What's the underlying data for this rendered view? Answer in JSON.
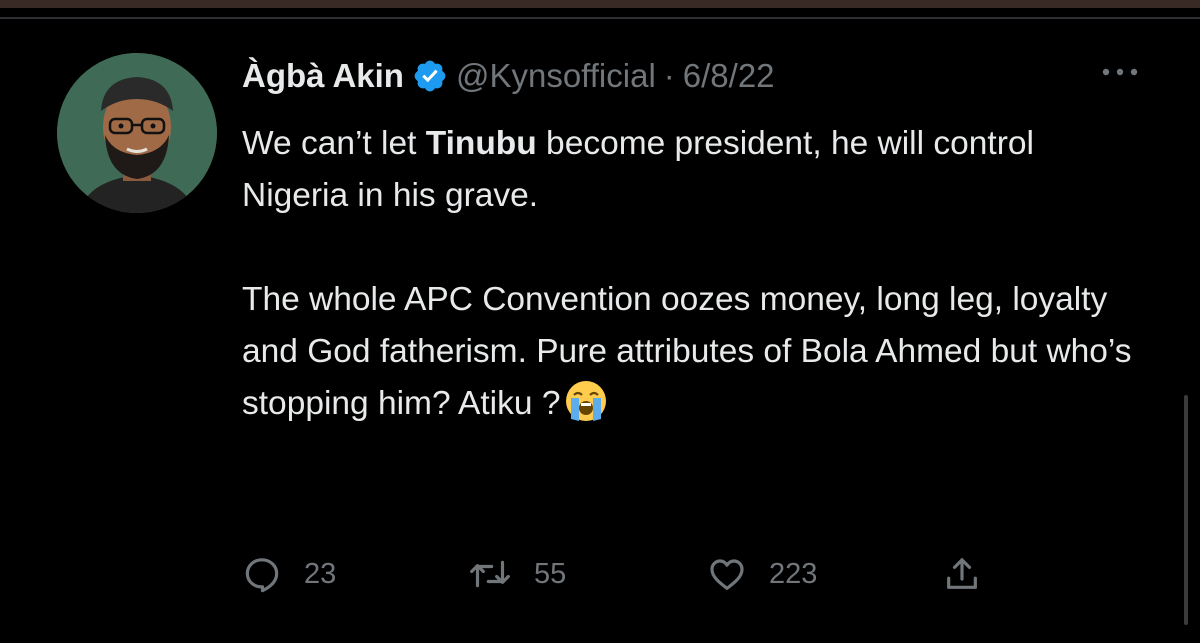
{
  "tweet": {
    "display_name": "Àgbà Akin",
    "handle": "@Kynsofficial",
    "separator": "·",
    "date": "6/8/22",
    "body": {
      "line1_before": "We can’t let ",
      "line1_bold": "Tinubu",
      "line1_after": " become president, he will control Nigeria in his grave.",
      "paragraph2": "The whole APC Convention oozes money, long leg, loyalty and God fatherism. Pure attributes of Bola Ahmed but who’s stopping him? Atiku ?"
    },
    "emoji": "loudly-crying-face",
    "metrics": {
      "replies": "23",
      "retweets": "55",
      "likes": "223"
    }
  },
  "icons": {
    "verified": "verified-badge-icon",
    "more": "more-options-icon",
    "reply": "reply-icon",
    "retweet": "retweet-icon",
    "like": "like-icon",
    "share": "share-icon"
  },
  "colors": {
    "background": "#000000",
    "text_primary": "#e7e9ea",
    "text_secondary": "#71767b",
    "verified_blue": "#1d9bf0",
    "avatar_bg": "#3f6a55"
  }
}
